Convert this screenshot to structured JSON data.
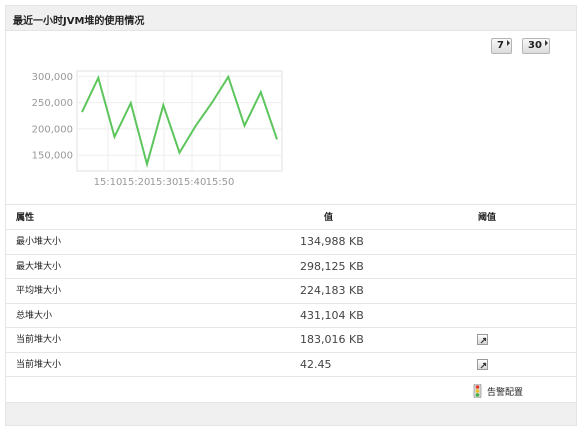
{
  "panel": {
    "title": "最近一小时JVM堆的使用情况"
  },
  "buttons": {
    "period_7": "7",
    "period_30": "30"
  },
  "chart_data": {
    "type": "line",
    "title": "",
    "xlabel": "",
    "ylabel": "",
    "x": [
      "15:03",
      "15:07",
      "15:11",
      "15:15",
      "15:19",
      "15:23",
      "15:27",
      "15:31",
      "15:35",
      "15:39",
      "15:43",
      "15:47",
      "15:51",
      "15:55",
      "15:59"
    ],
    "series": [
      {
        "values": [
          232000,
          297000,
          185000,
          249000,
          133000,
          245000,
          155000,
          206000,
          250000,
          299000,
          206000,
          270000,
          180000
        ]
      }
    ],
    "xticks": [
      "15:10",
      "15:20",
      "15:30",
      "15:40",
      "15:50"
    ],
    "yticks": [
      "150,000",
      "200,000",
      "250,000",
      "300,000"
    ],
    "ylim": [
      120000,
      310000
    ],
    "grid": true,
    "color": "#5cc65c"
  },
  "table": {
    "headers": {
      "name": "属性",
      "value": "值",
      "threshold": "阈值"
    },
    "rows": [
      {
        "name": "最小堆大小",
        "value": "134,988 KB"
      },
      {
        "name": "最大堆大小",
        "value": "298,125 KB"
      },
      {
        "name": "平均堆大小",
        "value": "224,183 KB"
      },
      {
        "name": "总堆大小",
        "value": "431,104 KB"
      },
      {
        "name": "当前堆大小",
        "value": "183,016 KB",
        "has_threshold": true
      },
      {
        "name": "当前堆大小",
        "value": "42.45",
        "has_threshold": true
      }
    ]
  },
  "alarm": {
    "label": "告警配置",
    "icon": "traffic-light-icon"
  }
}
